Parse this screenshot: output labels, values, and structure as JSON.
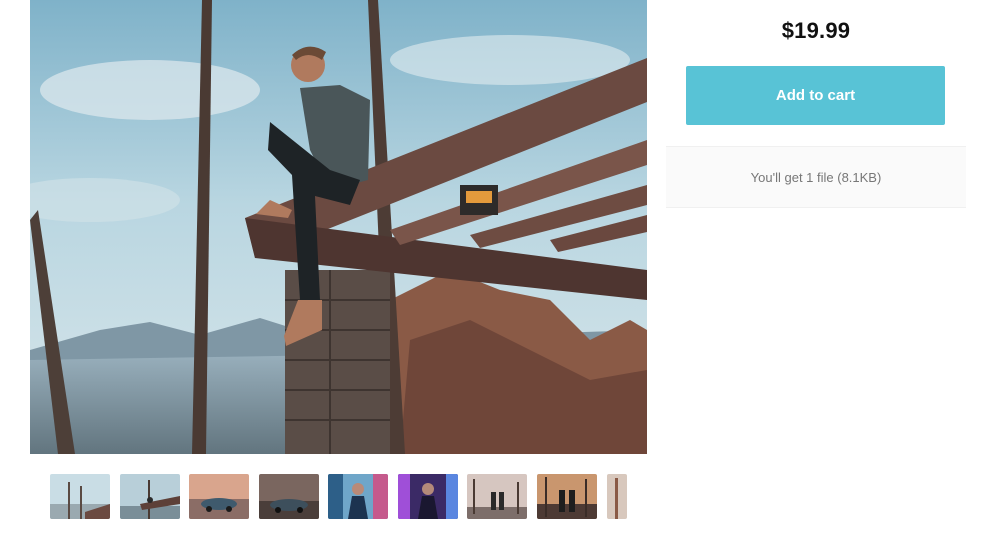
{
  "product": {
    "price": "$19.99",
    "add_to_cart_label": "Add to cart",
    "file_info": "You'll get 1 file (8.1KB)"
  },
  "gallery": {
    "thumbnails": [
      {
        "name": "thumbnail-1"
      },
      {
        "name": "thumbnail-2"
      },
      {
        "name": "thumbnail-3"
      },
      {
        "name": "thumbnail-4"
      },
      {
        "name": "thumbnail-5"
      },
      {
        "name": "thumbnail-6"
      },
      {
        "name": "thumbnail-7"
      },
      {
        "name": "thumbnail-8"
      },
      {
        "name": "thumbnail-9"
      }
    ]
  },
  "colors": {
    "accent": "#58c3d6",
    "price_text": "#111111",
    "info_text": "#777777"
  }
}
